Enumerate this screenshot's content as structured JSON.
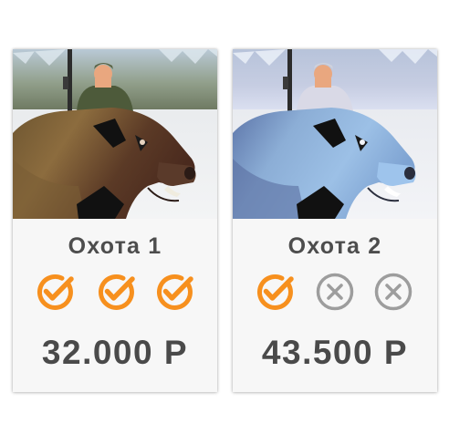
{
  "cards": [
    {
      "title": "Охота 1",
      "price": "32.000 Р",
      "image_icon": "boar-hunter-icon",
      "features": [
        "included",
        "included",
        "included"
      ]
    },
    {
      "title": "Охота 2",
      "price": "43.500 Р",
      "image_icon": "boar-hunter-icon",
      "features": [
        "included",
        "excluded",
        "excluded"
      ]
    }
  ],
  "colors": {
    "included": "#f7901e",
    "excluded": "#9d9d9d",
    "card_body": "#f7f7f7",
    "text": "#4a4a4a"
  },
  "icons": {
    "included": "check-circle-icon",
    "excluded": "cross-circle-icon"
  }
}
